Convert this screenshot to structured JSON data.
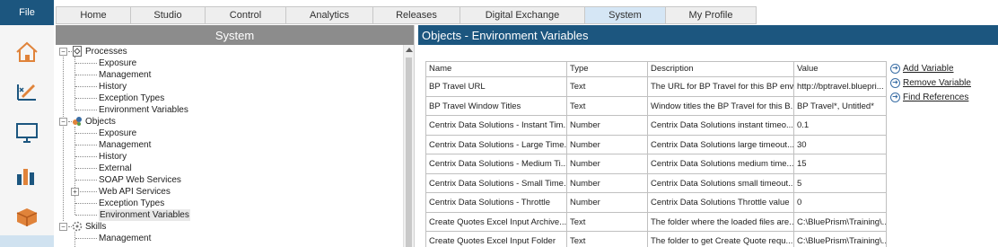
{
  "topbar": {
    "file_label": "File",
    "tabs": [
      "Home",
      "Studio",
      "Control",
      "Analytics",
      "Releases",
      "Digital Exchange",
      "System",
      "My Profile"
    ],
    "active_tab": "System"
  },
  "rail": {
    "icons": [
      "home-icon",
      "design-icon",
      "monitor-icon",
      "chart-icon",
      "package-icon"
    ]
  },
  "tree_panel": {
    "title": "System",
    "nodes": [
      {
        "label": "Processes",
        "level": 0,
        "expander": "−",
        "icon": "processes-icon"
      },
      {
        "label": "Exposure",
        "level": 1
      },
      {
        "label": "Management",
        "level": 1
      },
      {
        "label": "History",
        "level": 1
      },
      {
        "label": "Exception Types",
        "level": 1
      },
      {
        "label": "Environment Variables",
        "level": 1
      },
      {
        "label": "Objects",
        "level": 0,
        "expander": "−",
        "icon": "objects-icon"
      },
      {
        "label": "Exposure",
        "level": 1
      },
      {
        "label": "Management",
        "level": 1
      },
      {
        "label": "History",
        "level": 1
      },
      {
        "label": "External",
        "level": 1
      },
      {
        "label": "SOAP Web Services",
        "level": 1
      },
      {
        "label": "Web API Services",
        "level": 1,
        "expander": "+"
      },
      {
        "label": "Exception Types",
        "level": 1
      },
      {
        "label": "Environment Variables",
        "level": 1,
        "selected": true
      },
      {
        "label": "Skills",
        "level": 0,
        "expander": "−",
        "icon": "skills-icon"
      },
      {
        "label": "Management",
        "level": 1
      }
    ]
  },
  "main_panel": {
    "title": "Objects - Environment Variables",
    "columns": [
      "Name",
      "Type",
      "Description",
      "Value"
    ],
    "rows": [
      [
        "BP Travel URL",
        "Text",
        "The URL for BP Travel for this BP envi...",
        "http://bptravel.bluepri..."
      ],
      [
        "BP Travel Window Titles",
        "Text",
        "Window titles the BP Travel for this B...",
        "BP Travel*, Untitled*"
      ],
      [
        "Centrix Data Solutions - Instant Tim...",
        "Number",
        "Centrix Data Solutions instant timeo...",
        "0.1"
      ],
      [
        "Centrix Data Solutions - Large Time...",
        "Number",
        "Centrix Data Solutions large timeout...",
        "30"
      ],
      [
        "Centrix Data Solutions - Medium Ti...",
        "Number",
        "Centrix Data Solutions medium time...",
        "15"
      ],
      [
        "Centrix Data Solutions - Small Time...",
        "Number",
        "Centrix Data Solutions small timeout...",
        "5"
      ],
      [
        "Centrix Data Solutions - Throttle",
        "Number",
        "Centrix Data Solutions Throttle value",
        "0"
      ],
      [
        "Create Quotes Excel Input Archive...",
        "Text",
        "The folder where the loaded files are...",
        "C:\\BluePrism\\Training\\..."
      ],
      [
        "Create Quotes Excel Input Folder",
        "Text",
        "The folder to get Create Quote requ...",
        "C:\\BluePrism\\Training\\..."
      ]
    ],
    "actions": [
      {
        "label": "Add Variable",
        "icon": "add-icon"
      },
      {
        "label": "Remove Variable",
        "icon": "remove-icon"
      },
      {
        "label": "Find References",
        "icon": "find-icon"
      }
    ]
  },
  "colors": {
    "header_blue": "#1c567f",
    "header_gray": "#8c8c8c",
    "active_tab": "#d5e6f5"
  }
}
